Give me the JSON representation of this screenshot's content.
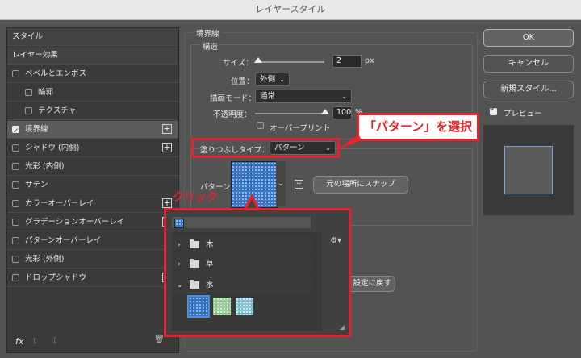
{
  "window": {
    "title": "レイヤースタイル"
  },
  "styles_panel": {
    "header_styles": "スタイル",
    "header_effects": "レイヤー効果",
    "items": [
      {
        "label": "ベベルとエンボス",
        "checked": false,
        "plus": false
      },
      {
        "label": "輪郭",
        "checked": false,
        "plus": false
      },
      {
        "label": "テクスチャ",
        "checked": false,
        "plus": false
      },
      {
        "label": "境界線",
        "checked": true,
        "plus": true
      },
      {
        "label": "シャドウ (内側)",
        "checked": false,
        "plus": true
      },
      {
        "label": "光彩 (内側)",
        "checked": false,
        "plus": false
      },
      {
        "label": "サテン",
        "checked": false,
        "plus": false
      },
      {
        "label": "カラーオーバーレイ",
        "checked": false,
        "plus": true
      },
      {
        "label": "グラデーションオーバーレイ",
        "checked": false,
        "plus": true
      },
      {
        "label": "パターンオーバーレイ",
        "checked": false,
        "plus": false
      },
      {
        "label": "光彩 (外側)",
        "checked": false,
        "plus": false
      },
      {
        "label": "ドロップシャドウ",
        "checked": false,
        "plus": true
      }
    ],
    "footer": {
      "fx": "fx",
      "up": "⇧",
      "down": "⇩",
      "trash": "🗑"
    }
  },
  "stroke": {
    "section_title": "境界線",
    "structure_title": "構造",
    "size_label": "サイズ：",
    "size_value": "2",
    "size_unit": "px",
    "position_label": "位置：",
    "position_value": "外側",
    "blend_label": "描画モード：",
    "blend_value": "通常",
    "opacity_label": "不透明度：",
    "opacity_value": "100",
    "opacity_unit": "%",
    "overprint_label": "オーバープリント",
    "overprint_checked": false,
    "fill_type_label": "塗りつぶしタイプ：",
    "fill_type_value": "パターン",
    "pattern_label": "パターン：",
    "snap_button": "元の場所にスナップ",
    "reset_button": "設定に戻す"
  },
  "pattern_picker": {
    "folders": [
      {
        "name": "木",
        "expanded": false
      },
      {
        "name": "草",
        "expanded": false
      },
      {
        "name": "水",
        "expanded": true
      }
    ],
    "swatch_colors": [
      "#3d78c8",
      "#9ccf9c",
      "#8cc6d6"
    ]
  },
  "buttons": {
    "ok": "OK",
    "cancel": "キャンセル",
    "new_style": "新規スタイル...",
    "preview_label": "プレビュー",
    "preview_checked": true
  },
  "annotations": {
    "callout": "「パターン」を選択",
    "click_label": "クリック",
    "accent": "#e4232b"
  }
}
